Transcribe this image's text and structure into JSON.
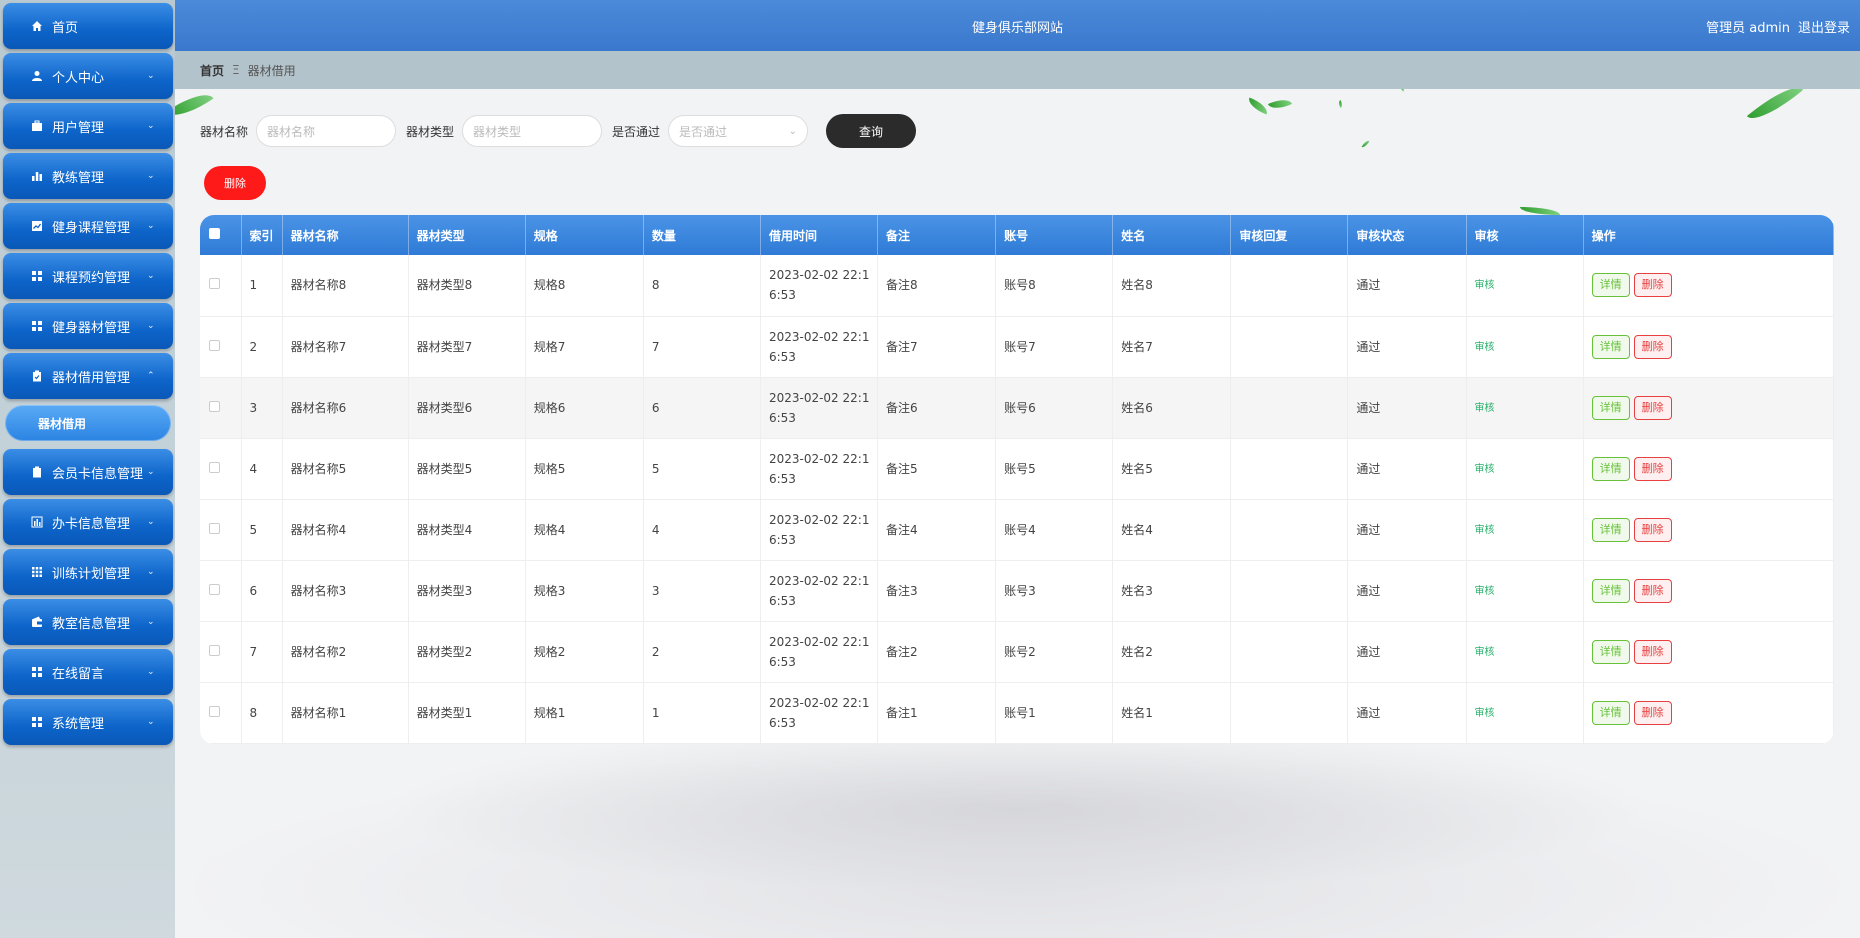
{
  "app": {
    "site_title": "健身俱乐部网站",
    "user_label": "管理员 admin",
    "logout_label": "退出登录"
  },
  "sidebar": {
    "items": [
      {
        "label": "首页",
        "icon": "home-icon",
        "has_arrow": false
      },
      {
        "label": "个人中心",
        "icon": "user-icon",
        "has_arrow": true
      },
      {
        "label": "用户管理",
        "icon": "briefcase-icon",
        "has_arrow": true
      },
      {
        "label": "教练管理",
        "icon": "bar-chart-icon",
        "has_arrow": true
      },
      {
        "label": "健身课程管理",
        "icon": "chart-box-icon",
        "has_arrow": true
      },
      {
        "label": "课程预约管理",
        "icon": "grid-icon",
        "has_arrow": true
      },
      {
        "label": "健身器材管理",
        "icon": "grid-icon",
        "has_arrow": true
      },
      {
        "label": "器材借用管理",
        "icon": "clipboard-icon",
        "has_arrow": true,
        "expanded": true
      },
      {
        "label": "会员卡信息管理",
        "icon": "clipboard-icon",
        "has_arrow": true
      },
      {
        "label": "办卡信息管理",
        "icon": "bar-chart-icon",
        "has_arrow": true
      },
      {
        "label": "训练计划管理",
        "icon": "grid-dots-icon",
        "has_arrow": true
      },
      {
        "label": "教室信息管理",
        "icon": "wallet-icon",
        "has_arrow": true
      },
      {
        "label": "在线留言",
        "icon": "grid-icon",
        "has_arrow": true
      },
      {
        "label": "系统管理",
        "icon": "grid-icon",
        "has_arrow": true
      }
    ],
    "sub_item": "器材借用"
  },
  "breadcrumb": {
    "home": "首页",
    "separator": "Ξ",
    "current": "器材借用"
  },
  "filters": {
    "name_label": "器材名称",
    "name_placeholder": "器材名称",
    "type_label": "器材类型",
    "type_placeholder": "器材类型",
    "pass_label": "是否通过",
    "pass_placeholder": "是否通过",
    "query_label": "查询"
  },
  "toolbar": {
    "delete_label": "删除"
  },
  "table": {
    "headers": [
      "索引",
      "器材名称",
      "器材类型",
      "规格",
      "数量",
      "借用时间",
      "备注",
      "账号",
      "姓名",
      "审核回复",
      "审核状态",
      "审核",
      "操作"
    ],
    "rows": [
      {
        "index": "1",
        "name": "器材名称8",
        "type": "器材类型8",
        "spec": "规格8",
        "qty": "8",
        "time1": "2023-02-02 22:1",
        "time2": "6:53",
        "note": "备注8",
        "account": "账号8",
        "person": "姓名8",
        "reply": "",
        "status": "通过",
        "audit": "审核",
        "detail": "详情",
        "delete": "删除"
      },
      {
        "index": "2",
        "name": "器材名称7",
        "type": "器材类型7",
        "spec": "规格7",
        "qty": "7",
        "time1": "2023-02-02 22:1",
        "time2": "6:53",
        "note": "备注7",
        "account": "账号7",
        "person": "姓名7",
        "reply": "",
        "status": "通过",
        "audit": "审核",
        "detail": "详情",
        "delete": "删除"
      },
      {
        "index": "3",
        "name": "器材名称6",
        "type": "器材类型6",
        "spec": "规格6",
        "qty": "6",
        "time1": "2023-02-02 22:1",
        "time2": "6:53",
        "note": "备注6",
        "account": "账号6",
        "person": "姓名6",
        "reply": "",
        "status": "通过",
        "audit": "审核",
        "detail": "详情",
        "delete": "删除"
      },
      {
        "index": "4",
        "name": "器材名称5",
        "type": "器材类型5",
        "spec": "规格5",
        "qty": "5",
        "time1": "2023-02-02 22:1",
        "time2": "6:53",
        "note": "备注5",
        "account": "账号5",
        "person": "姓名5",
        "reply": "",
        "status": "通过",
        "audit": "审核",
        "detail": "详情",
        "delete": "删除"
      },
      {
        "index": "5",
        "name": "器材名称4",
        "type": "器材类型4",
        "spec": "规格4",
        "qty": "4",
        "time1": "2023-02-02 22:1",
        "time2": "6:53",
        "note": "备注4",
        "account": "账号4",
        "person": "姓名4",
        "reply": "",
        "status": "通过",
        "audit": "审核",
        "detail": "详情",
        "delete": "删除"
      },
      {
        "index": "6",
        "name": "器材名称3",
        "type": "器材类型3",
        "spec": "规格3",
        "qty": "3",
        "time1": "2023-02-02 22:1",
        "time2": "6:53",
        "note": "备注3",
        "account": "账号3",
        "person": "姓名3",
        "reply": "",
        "status": "通过",
        "audit": "审核",
        "detail": "详情",
        "delete": "删除"
      },
      {
        "index": "7",
        "name": "器材名称2",
        "type": "器材类型2",
        "spec": "规格2",
        "qty": "2",
        "time1": "2023-02-02 22:1",
        "time2": "6:53",
        "note": "备注2",
        "account": "账号2",
        "person": "姓名2",
        "reply": "",
        "status": "通过",
        "audit": "审核",
        "detail": "详情",
        "delete": "删除"
      },
      {
        "index": "8",
        "name": "器材名称1",
        "type": "器材类型1",
        "spec": "规格1",
        "qty": "1",
        "time1": "2023-02-02 22:1",
        "time2": "6:53",
        "note": "备注1",
        "account": "账号1",
        "person": "姓名1",
        "reply": "",
        "status": "通过",
        "audit": "审核",
        "detail": "详情",
        "delete": "删除"
      }
    ]
  },
  "colors": {
    "header_blue": "#3a78cd",
    "menu_blue": "#0d64c9",
    "danger": "#ff1a1a",
    "success": "#67c23a"
  }
}
